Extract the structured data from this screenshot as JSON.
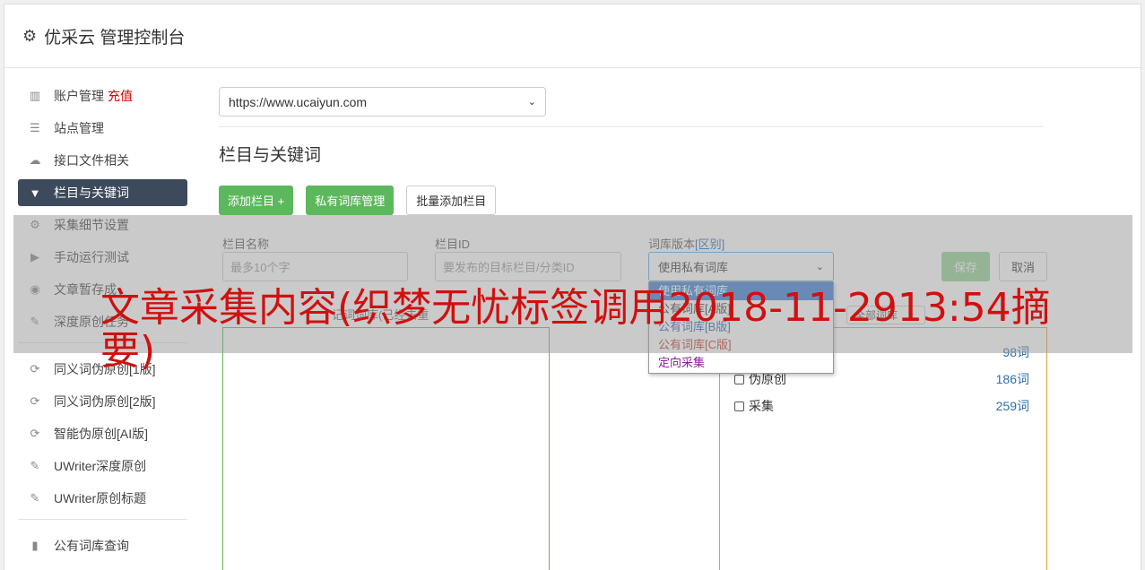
{
  "app": {
    "title": "优采云 管理控制台",
    "icon": "gear-icon"
  },
  "sidebar": {
    "items": [
      {
        "label": "账户管理",
        "icon": "bar-chart-icon",
        "badge": "充值"
      },
      {
        "label": "站点管理",
        "icon": "server-icon"
      },
      {
        "label": "接口文件相关",
        "icon": "cloud-upload-icon"
      },
      {
        "label": "栏目与关键词",
        "icon": "filter-icon",
        "active": true
      },
      {
        "label": "采集细节设置",
        "icon": "cogs-icon"
      },
      {
        "label": "手动运行测试",
        "icon": "play-circle-icon"
      },
      {
        "label": "文章暂存成",
        "icon": "database-icon"
      },
      {
        "label": "深度原创任务",
        "icon": "edit-icon"
      },
      {
        "label": "同义词伪原创[1版]",
        "icon": "refresh-icon"
      },
      {
        "label": "同义词伪原创[2版]",
        "icon": "refresh-icon"
      },
      {
        "label": "智能伪原创[AI版]",
        "icon": "refresh-icon"
      },
      {
        "label": "UWriter深度原创",
        "icon": "edit-icon"
      },
      {
        "label": "UWriter原创标题",
        "icon": "edit-icon"
      },
      {
        "label": "公有词库查询",
        "icon": "book-icon"
      }
    ]
  },
  "main": {
    "site_select": "https://www.ucaiyun.com",
    "section_title": "栏目与关键词",
    "buttons": {
      "add_column": "添加栏目 +",
      "private_lib": "私有词库管理",
      "batch_add": "批量添加栏目"
    },
    "form": {
      "name_label": "栏目名称",
      "name_placeholder": "最多10个字",
      "id_label": "栏目ID",
      "id_placeholder": "要发布的目标栏目/分类ID",
      "lib_label": "词库版本",
      "lib_diff": "[区别]",
      "lib_value": "使用私有词库",
      "save": "保存",
      "cancel": "取消",
      "keyword_hint": "记词词库(已经去重",
      "all_lib": "全部词库"
    },
    "dropdown_options": [
      {
        "label": "使用私有词库",
        "color": "#ffffff",
        "selected": true
      },
      {
        "label": "公有词库[A版]",
        "color": "#333333"
      },
      {
        "label": "公有词库[B版]",
        "color": "#2a5db0"
      },
      {
        "label": "公有词库[C版]",
        "color": "#c0392b"
      },
      {
        "label": "定向采集",
        "color": "#8e1b9e"
      }
    ],
    "lib_rows": [
      {
        "label": "",
        "count": "98词"
      },
      {
        "label": "伪原创",
        "count": "186词"
      },
      {
        "label": "采集",
        "count": "259词"
      }
    ]
  },
  "watermark": "文章采集内容(织梦无忧标签调用2018-11-2913:54摘要)"
}
